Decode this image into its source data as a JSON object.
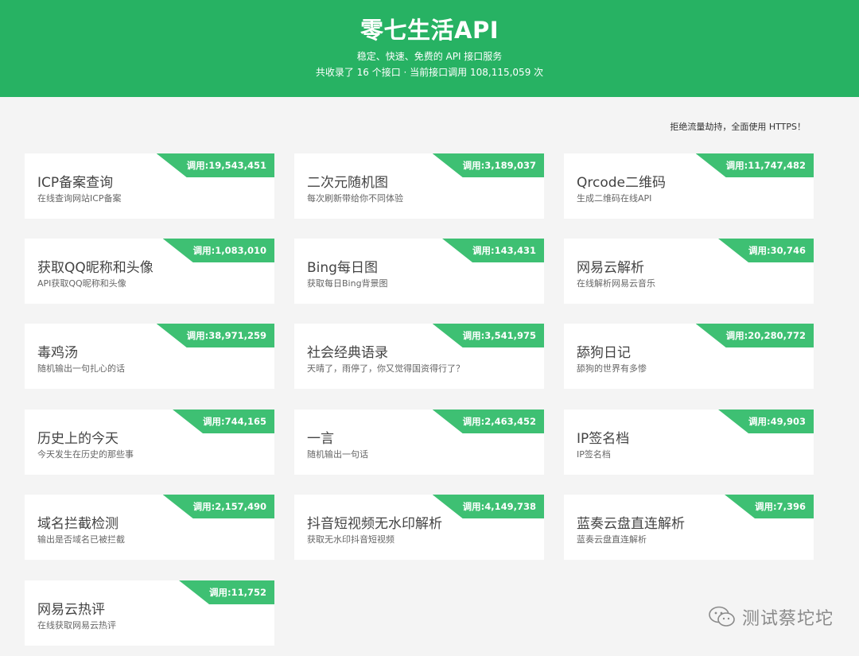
{
  "header": {
    "title": "零七生活API",
    "subtitle": "稳定、快速、免费的 API 接口服务",
    "stats": "共收录了 16 个接口 · 当前接口调用 108,115,059 次"
  },
  "notice": "拒绝流量劫持，全面使用 HTTPS！",
  "cards": [
    {
      "title": "ICP备案查询",
      "desc": "在线查询网站ICP备案",
      "calls": "调用:19,543,451"
    },
    {
      "title": "二次元随机图",
      "desc": "每次刷新带给你不同体验",
      "calls": "调用:3,189,037"
    },
    {
      "title": "Qrcode二维码",
      "desc": "生成二维码在线API",
      "calls": "调用:11,747,482"
    },
    {
      "title": "获取QQ昵称和头像",
      "desc": "API获取QQ昵称和头像",
      "calls": "调用:1,083,010"
    },
    {
      "title": "Bing每日图",
      "desc": "获取每日Bing背景图",
      "calls": "调用:143,431"
    },
    {
      "title": "网易云解析",
      "desc": "在线解析网易云音乐",
      "calls": "调用:30,746"
    },
    {
      "title": "毒鸡汤",
      "desc": "随机输出一句扎心的话",
      "calls": "调用:38,971,259"
    },
    {
      "title": "社会经典语录",
      "desc": "天晴了，雨停了，你又觉得国资得行了？",
      "calls": "调用:3,541,975"
    },
    {
      "title": "舔狗日记",
      "desc": "舔狗的世界有多惨",
      "calls": "调用:20,280,772"
    },
    {
      "title": "历史上的今天",
      "desc": "今天发生在历史的那些事",
      "calls": "调用:744,165"
    },
    {
      "title": "一言",
      "desc": "随机输出一句话",
      "calls": "调用:2,463,452"
    },
    {
      "title": "IP签名档",
      "desc": "IP签名档",
      "calls": "调用:49,903"
    },
    {
      "title": "域名拦截检测",
      "desc": "输出是否域名已被拦截",
      "calls": "调用:2,157,490"
    },
    {
      "title": "抖音短视频无水印解析",
      "desc": "获取无水印抖音短视频",
      "calls": "调用:4,149,738"
    },
    {
      "title": "蓝奏云盘直连解析",
      "desc": "蓝奏云盘直连解析",
      "calls": "调用:7,396"
    },
    {
      "title": "网易云热评",
      "desc": "在线获取网易云热评",
      "calls": "调用:11,752"
    }
  ],
  "watermark": {
    "icon": "wechat-icon",
    "text": "测试蔡坨坨"
  },
  "colors": {
    "header": "#27b263",
    "ribbon": "#3ec073",
    "background": "#f4f4f4"
  }
}
